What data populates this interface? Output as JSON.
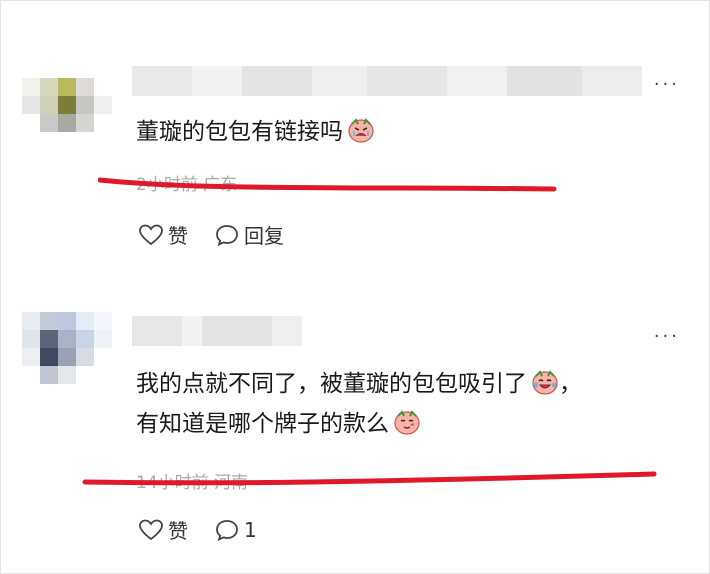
{
  "comments": [
    {
      "text_lines": [
        "董璇的包包有链接吗"
      ],
      "meta": "2小时前 广东",
      "like_label": "赞",
      "reply_label": "回复",
      "more_label": "···",
      "emoji": [
        "crying-face-icon"
      ]
    },
    {
      "text_lines": [
        "我的点就不同了，被董璇的包包吸引了",
        "有知道是哪个牌子的款么"
      ],
      "line1_tail": "，",
      "meta": "14小时前 河南",
      "like_label": "赞",
      "reply_label": "1",
      "more_label": "···",
      "emoji": [
        "tearful-laugh-icon",
        "blushing-face-icon"
      ]
    }
  ],
  "colors": {
    "annotation_red": "#e0182b",
    "meta_gray": "#a9a9a9",
    "text": "#1a1a1a"
  }
}
